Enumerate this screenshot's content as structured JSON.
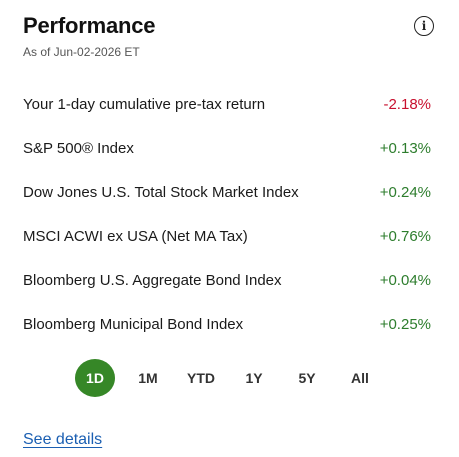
{
  "header": {
    "title": "Performance",
    "as_of": "As of Jun-02-2026 ET",
    "info_icon_glyph": "i"
  },
  "rows": [
    {
      "label": "Your 1-day cumulative pre-tax return",
      "value": "-2.18%",
      "trend": "negative"
    },
    {
      "label": "S&P 500® Index",
      "value": "+0.13%",
      "trend": "positive"
    },
    {
      "label": "Dow Jones U.S. Total Stock Market Index",
      "value": "+0.24%",
      "trend": "positive"
    },
    {
      "label": "MSCI ACWI ex USA (Net MA Tax)",
      "value": "+0.76%",
      "trend": "positive"
    },
    {
      "label": "Bloomberg U.S. Aggregate Bond Index",
      "value": "+0.04%",
      "trend": "positive"
    },
    {
      "label": "Bloomberg Municipal Bond Index",
      "value": "+0.25%",
      "trend": "positive"
    }
  ],
  "periods": {
    "options": [
      "1D",
      "1M",
      "YTD",
      "1Y",
      "5Y",
      "All"
    ],
    "selected": "1D"
  },
  "footer": {
    "link_label": "See details"
  },
  "colors": {
    "negative": "#c8102e",
    "positive": "#2d7d2d",
    "accent": "#368727",
    "link": "#1b5fb2"
  }
}
